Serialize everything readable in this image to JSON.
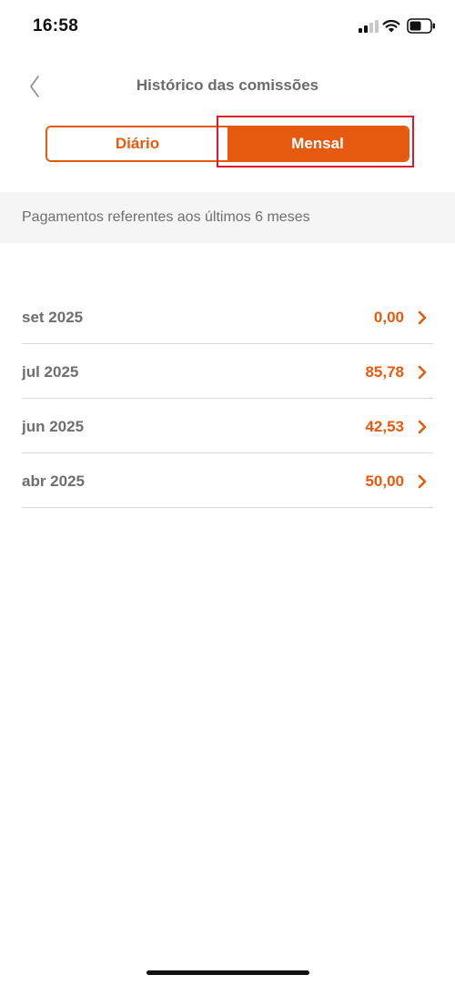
{
  "status_bar": {
    "time": "16:58",
    "icons": [
      "signal-icon",
      "wifi-icon",
      "battery-icon"
    ]
  },
  "header": {
    "title": "Histórico das comissões",
    "back_icon": "chevron-left-icon"
  },
  "segmented_control": {
    "options": [
      {
        "label": "Diário",
        "selected": false
      },
      {
        "label": "Mensal",
        "selected": true
      }
    ]
  },
  "info": {
    "text": "Pagamentos referentes aos últimos 6 meses"
  },
  "payments": [
    {
      "month": "set 2025",
      "value": "0,00"
    },
    {
      "month": "jul 2025",
      "value": "85,78"
    },
    {
      "month": "jun 2025",
      "value": "42,53"
    },
    {
      "month": "abr 2025",
      "value": "50,00"
    }
  ],
  "colors": {
    "accent": "#e55a0e",
    "highlight": "#e0182b",
    "text_secondary": "#6e6e6e",
    "band_background": "#f5f5f5"
  }
}
